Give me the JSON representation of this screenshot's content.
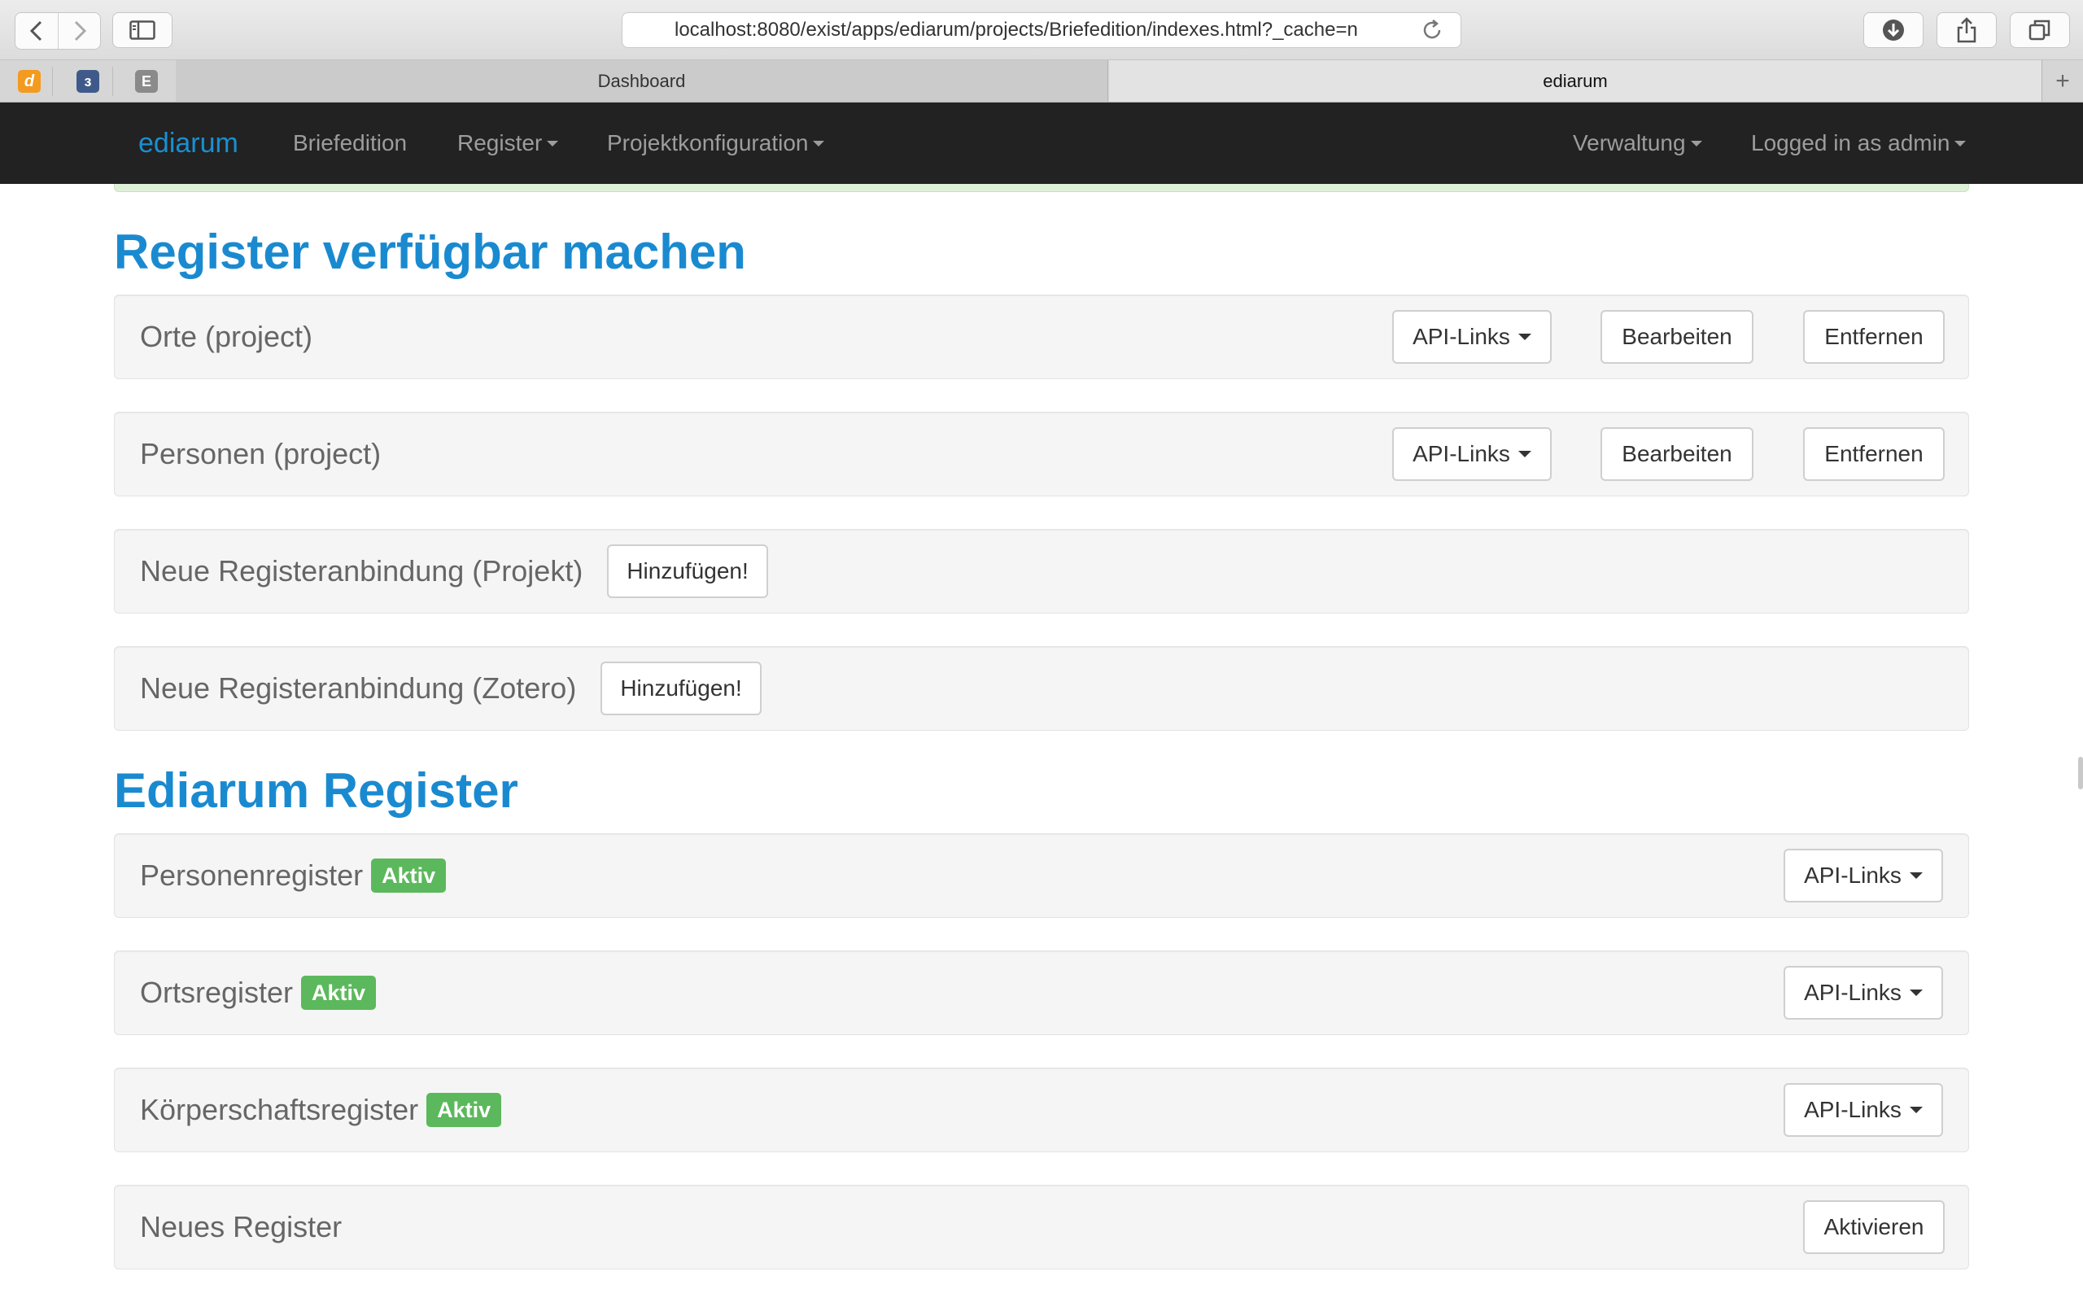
{
  "browser": {
    "url": "localhost:8080/exist/apps/ediarum/projects/Briefedition/indexes.html?_cache=n",
    "tabs": [
      {
        "label": "Dashboard",
        "active": false
      },
      {
        "label": "ediarum",
        "active": true
      }
    ],
    "favorites": [
      {
        "glyph": "d",
        "icon": "d-favicon"
      },
      {
        "glyph": "ɜ",
        "icon": "s-favicon"
      },
      {
        "glyph": "E",
        "icon": "e-favicon"
      }
    ],
    "new_tab_glyph": "+"
  },
  "navbar": {
    "brand": "ediarum",
    "items": [
      "Briefedition",
      "Register",
      "Projektkonfiguration"
    ],
    "right_items": [
      "Verwaltung",
      "Logged in as admin"
    ]
  },
  "sections": {
    "available": {
      "title": "Register verfügbar machen",
      "panels": [
        {
          "label": "Orte (project)",
          "api_links": "API-Links",
          "edit": "Bearbeiten",
          "remove": "Entfernen"
        },
        {
          "label": "Personen (project)",
          "api_links": "API-Links",
          "edit": "Bearbeiten",
          "remove": "Entfernen"
        },
        {
          "label": "Neue Registeranbindung (Projekt)",
          "add": "Hinzufügen!"
        },
        {
          "label": "Neue Registeranbindung (Zotero)",
          "add": "Hinzufügen!"
        }
      ]
    },
    "ediarum": {
      "title": "Ediarum Register",
      "panels": [
        {
          "label": "Personenregister",
          "badge": "Aktiv",
          "api_links": "API-Links"
        },
        {
          "label": "Ortsregister",
          "badge": "Aktiv",
          "api_links": "API-Links"
        },
        {
          "label": "Körperschaftsregister",
          "badge": "Aktiv",
          "api_links": "API-Links"
        },
        {
          "label": "Neues Register",
          "activate": "Aktivieren"
        }
      ]
    }
  },
  "colors": {
    "brand": "#1a8fd1",
    "heading": "#1a8ad0",
    "navbar_bg": "#222222",
    "badge_success": "#5cb85c"
  }
}
